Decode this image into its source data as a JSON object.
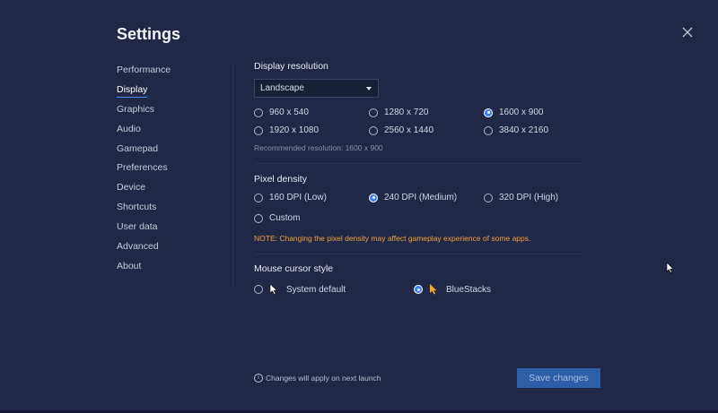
{
  "window": {
    "title": "Settings"
  },
  "sidebar": {
    "items": [
      {
        "label": "Performance"
      },
      {
        "label": "Display",
        "active": true
      },
      {
        "label": "Graphics"
      },
      {
        "label": "Audio"
      },
      {
        "label": "Gamepad"
      },
      {
        "label": "Preferences"
      },
      {
        "label": "Device"
      },
      {
        "label": "Shortcuts"
      },
      {
        "label": "User data"
      },
      {
        "label": "Advanced"
      },
      {
        "label": "About"
      }
    ]
  },
  "display_resolution": {
    "title": "Display resolution",
    "orientation": "Landscape",
    "options": [
      {
        "label": "960 x 540",
        "selected": false
      },
      {
        "label": "1280 x 720",
        "selected": false
      },
      {
        "label": "1600 x 900",
        "selected": true
      },
      {
        "label": "1920 x 1080",
        "selected": false
      },
      {
        "label": "2560 x 1440",
        "selected": false
      },
      {
        "label": "3840 x 2160",
        "selected": false
      }
    ],
    "recommended": "Recommended resolution: 1600 x 900"
  },
  "pixel_density": {
    "title": "Pixel density",
    "options": [
      {
        "label": "160 DPI (Low)",
        "selected": false
      },
      {
        "label": "240 DPI (Medium)",
        "selected": true
      },
      {
        "label": "320 DPI (High)",
        "selected": false
      },
      {
        "label": "Custom",
        "selected": false
      }
    ],
    "note": "NOTE: Changing the pixel density may affect gameplay experience of some apps."
  },
  "mouse_cursor": {
    "title": "Mouse cursor style",
    "options": [
      {
        "label": "System default",
        "selected": false,
        "icon": "white-cursor-icon"
      },
      {
        "label": "BlueStacks",
        "selected": true,
        "icon": "orange-cursor-icon"
      }
    ]
  },
  "footer": {
    "info": "Changes will apply on next launch",
    "save_label": "Save changes"
  },
  "colors": {
    "background": "#212847",
    "accent": "#3b7ff5",
    "note": "#f2a23b",
    "save_button": "#2d5ea8"
  }
}
